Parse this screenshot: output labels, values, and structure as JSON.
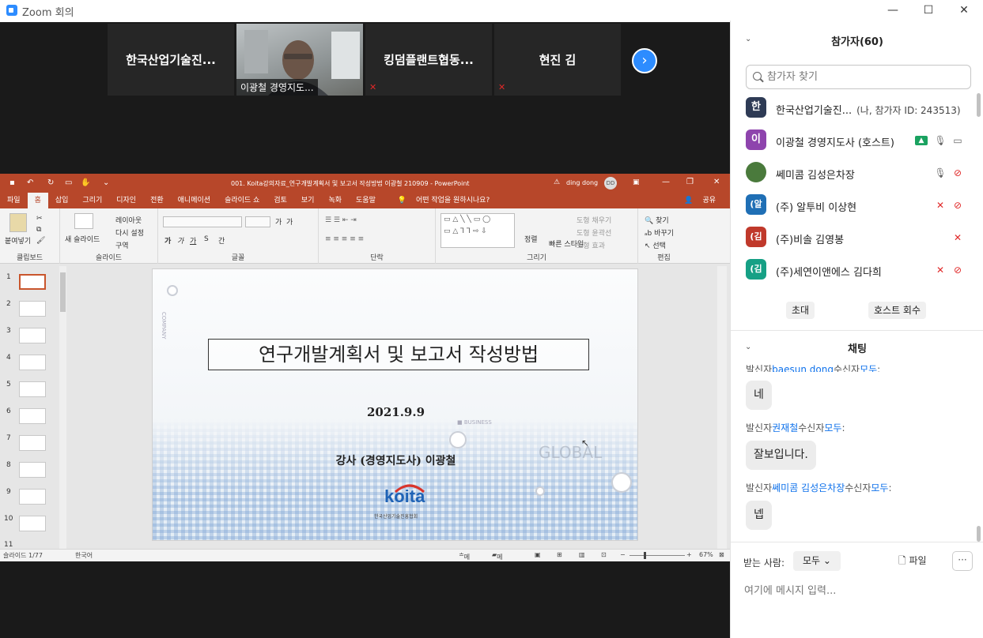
{
  "window": {
    "title": "Zoom 회의",
    "minimize": "—",
    "maximize": "☐",
    "close": "✕"
  },
  "gallery": {
    "tiles": [
      {
        "name": "한국산업기술진..."
      },
      {
        "name": "이광철 경영지도..."
      },
      {
        "name": "킹덤플랜트협동..."
      },
      {
        "name": "현진 김"
      }
    ],
    "next_icon": "›"
  },
  "ppt": {
    "file_title": "001. Koita강의자료_연구개발계획서 및 보고서 작성방법 이광철 210909  -  PowerPoint",
    "user": "ding dong",
    "user_initials": "DD",
    "tabs": [
      "파일",
      "홈",
      "삽입",
      "그리기",
      "디자인",
      "전환",
      "애니메이션",
      "슬라이드 쇼",
      "검토",
      "보기",
      "녹화",
      "도움말"
    ],
    "tell_me": "어떤 작업을 원하시나요?",
    "share": "공유",
    "ribbon": {
      "clipboard": {
        "label": "클립보드",
        "paste": "붙여넣기"
      },
      "slides": {
        "label": "슬라이드",
        "new_slide": "새 슬라이드",
        "layout": "레이아웃",
        "reset": "다시 설정",
        "section": "구역"
      },
      "font": {
        "label": "글꼴",
        "bold": "가",
        "italic": "가",
        "underline": "가",
        "shadow": "S",
        "spacing": "간",
        "size_up": "가",
        "size_down": "가"
      },
      "paragraph": {
        "label": "단락"
      },
      "drawing": {
        "label": "그리기",
        "arrange": "정렬",
        "quick_styles": "빠른 스타일",
        "fill": "도형 채우기",
        "outline": "도형 윤곽선",
        "effects": "도형 효과"
      },
      "editing": {
        "label": "편집",
        "find": "찾기",
        "replace": "바꾸기",
        "select": "선택"
      }
    },
    "thumbnails": [
      "1",
      "2",
      "3",
      "4",
      "5",
      "6",
      "7",
      "8",
      "9",
      "10",
      "11"
    ],
    "slide": {
      "title": "연구개발계획서 및 보고서 작성방법",
      "date": "2021.9.9",
      "lecturer": "강사 (경영지도사) 이광철",
      "logo": "koita",
      "logo_sub": "한국산업기술진흥협회",
      "word_global": "GLOBAL",
      "word_business": "■ BUSINESS",
      "word_company": "COMPANY"
    },
    "status": {
      "slide_count": "슬라이드 1/77",
      "language": "한국어",
      "notes": "메모",
      "comments": "메모",
      "zoom": "67%"
    }
  },
  "participants": {
    "header": "참가자(60)",
    "search_placeholder": "참가자 찾기",
    "list": [
      {
        "avatar": "한",
        "name": "한국산업기술진...",
        "meta": "(나, 참가자 ID: 243513)",
        "color": "#2e3b55"
      },
      {
        "avatar": "이",
        "name": "이광철 경영지도사 (호스트)",
        "meta": "",
        "color": "#8e44ad"
      },
      {
        "avatar": "",
        "name": "쎄미콤 김성은차장",
        "meta": "",
        "color": "#4a7a3c"
      },
      {
        "avatar": "(알",
        "name": "(주) 알투비 이상현",
        "meta": "",
        "color": "#1f6fb5"
      },
      {
        "avatar": "(김",
        "name": "(주)비솔 김영봉",
        "meta": "",
        "color": "#c0392b"
      },
      {
        "avatar": "(김",
        "name": "(주)세연이앤에스 김다희",
        "meta": "",
        "color": "#16a085"
      }
    ],
    "invite": "초대",
    "reclaim_host": "호스트 회수"
  },
  "chat": {
    "header": "채팅",
    "messages": [
      {
        "prefix": "발신자",
        "sender": "baesun dong",
        "mid": "수신자",
        "to": "모두",
        "suffix": ":",
        "text": "네"
      },
      {
        "prefix": "발신자",
        "sender": "권재철",
        "mid": "수신자",
        "to": "모두",
        "suffix": ":",
        "text": "잘보입니다."
      },
      {
        "prefix": "발신자",
        "sender": "쎄미콤 김성은차장",
        "mid": "수신자",
        "to": "모두",
        "suffix": ":",
        "text": "넵"
      }
    ],
    "recipient_label": "받는 사람:",
    "recipient_value": "모두",
    "file_label": "파일",
    "more": "···",
    "input_placeholder": "여기에 메시지 입력..."
  }
}
